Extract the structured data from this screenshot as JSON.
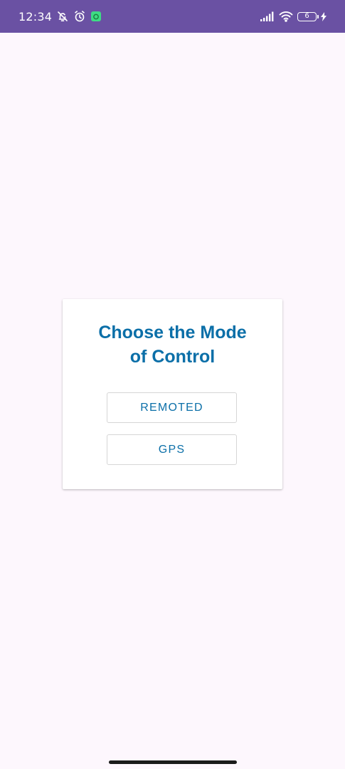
{
  "status_bar": {
    "time": "12:34",
    "battery_level": "6",
    "icons": [
      "notifications-off-icon",
      "alarm-icon",
      "app-notification-icon",
      "signal-icon",
      "wifi-icon",
      "battery-icon",
      "charging-icon"
    ],
    "colors": {
      "background": "#6a51a3",
      "app_badge": "#3ddc84"
    }
  },
  "dialog": {
    "title": "Choose the Mode\nof Control",
    "buttons": [
      {
        "label": "REMOTED"
      },
      {
        "label": "GPS"
      }
    ]
  },
  "colors": {
    "page_background": "#fdf7fd",
    "accent": "#0b6fa8",
    "card_background": "#ffffff"
  }
}
